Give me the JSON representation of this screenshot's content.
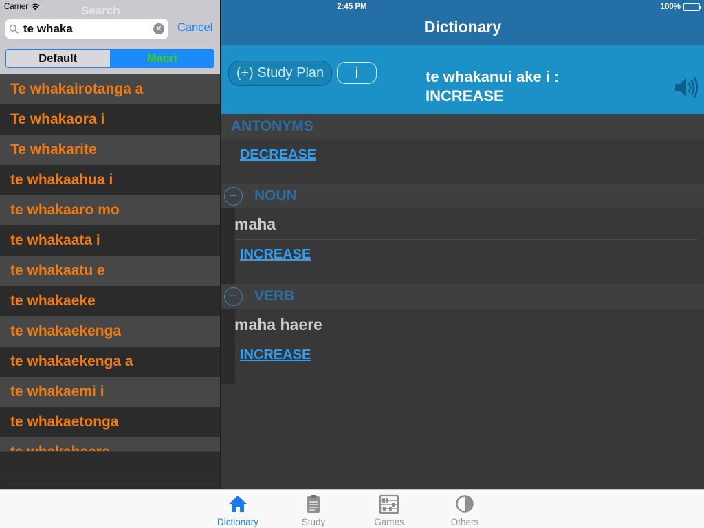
{
  "status_bar": {
    "carrier": "Carrier",
    "time": "2:45 PM",
    "battery": "100%",
    "battery_level": 1.0
  },
  "search": {
    "ghost_title": "Search",
    "query": "te whaka",
    "cancel_label": "Cancel",
    "icons": {
      "search": "magnifier-icon",
      "clear": "clear-x-icon"
    }
  },
  "language_toggle": {
    "options": [
      "Default",
      "Maori"
    ],
    "selected": "Maori"
  },
  "results": [
    "Te whakairotanga a",
    "Te whakaora i",
    "Te whakarite",
    "te whakaahua i",
    "te whakaaro mo",
    "te whakaata i",
    "te whakaatu e",
    "te whakaeke",
    "te whakaekenga",
    "te whakaekenga a",
    "te whakaemi i",
    "te whakaetonga",
    "te whakahaere"
  ],
  "detail": {
    "nav_title": "Dictionary",
    "study_plan_label": "(+) Study Plan",
    "info_label": "i",
    "headword_line1": "te whakanui ake i :",
    "headword_line2": "INCREASE",
    "speaker_icon": "speaker-icon",
    "antonyms": {
      "title": "ANTONYMS",
      "items": [
        "DECREASE"
      ]
    },
    "noun": {
      "collapse": "−",
      "title": "NOUN",
      "gloss": "maha",
      "link": "INCREASE"
    },
    "verb": {
      "collapse": "−",
      "title": "VERB",
      "gloss": "maha haere",
      "link": "INCREASE"
    }
  },
  "tabbar": {
    "tabs": [
      {
        "label": "Dictionary",
        "icon": "home-icon",
        "active": true
      },
      {
        "label": "Study",
        "icon": "clipboard-icon",
        "active": false
      },
      {
        "label": "Games",
        "icon": "abacus-icon",
        "active": false
      },
      {
        "label": "Others",
        "icon": "half-circle-icon",
        "active": false
      }
    ]
  },
  "colors": {
    "nav_blue": "#2470a6",
    "entry_blue": "#1b91c7",
    "result_orange": "#f07b12",
    "link_blue": "#2d9ef2",
    "section_blue": "#2e6da3",
    "tab_active": "#1a7bf0",
    "seg_selected_text": "#39d11a"
  }
}
